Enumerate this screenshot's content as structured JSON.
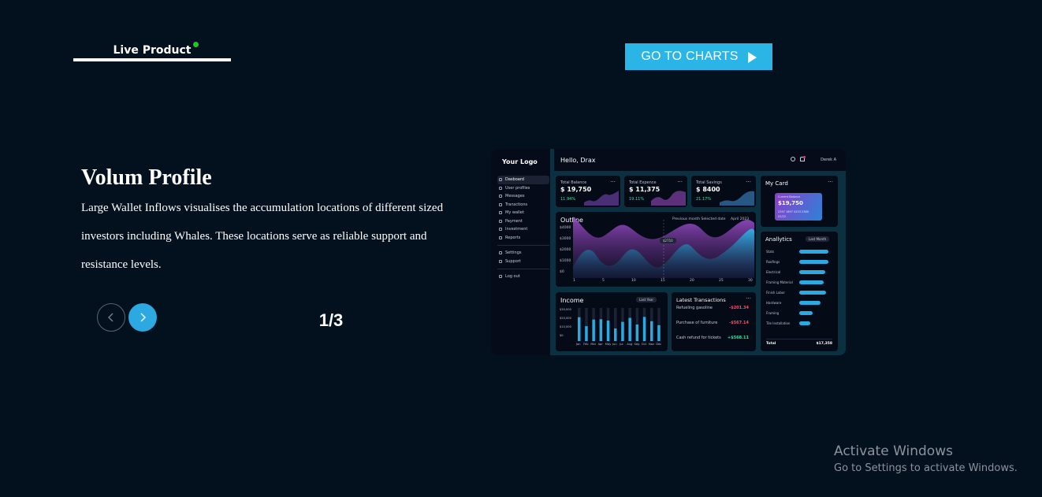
{
  "nav": {
    "tab_label": "Live Product"
  },
  "cta": {
    "label": "GO TO CHARTS"
  },
  "slide": {
    "title": "Volum Profile",
    "description": "Large Wallet Inflows visualises the accumulation locations of different sized investors including Whales. These locations serve as reliable support and resistance levels.",
    "counter": "1/3"
  },
  "preview": {
    "logo": "Your Logo",
    "greeting": "Hello, Drax",
    "user": "Derek A",
    "menu": [
      "Dasboard",
      "User profiles",
      "Messages",
      "Transctions",
      "My wallet",
      "Payment",
      "Investment",
      "Reports"
    ],
    "menu_bottom": [
      "Settings",
      "Support"
    ],
    "logout": "Log out",
    "cards": [
      {
        "title": "Total Balance",
        "value": "$ 19,750",
        "pct": "11.94%"
      },
      {
        "title": "Total Expence",
        "value": "$ 11,375",
        "pct": "19.11%"
      },
      {
        "title": "Total Savings",
        "value": "$ 8400",
        "pct": "21.17%"
      }
    ],
    "my_card": {
      "title": "My Card",
      "label": "Current Balance",
      "value": "$19,750",
      "number": "2357 1897 4253 2380",
      "expiry": "02/22"
    },
    "outline": {
      "title": "Outline",
      "legend": "Previous month  Selected date",
      "period": "April 2023",
      "tooltip": "$2710",
      "y_ticks": [
        "$4000",
        "$3000",
        "$2000",
        "$1000",
        "$0"
      ],
      "x_ticks": [
        "1",
        "5",
        "10",
        "15",
        "20",
        "25",
        "30"
      ]
    },
    "analytics": {
      "title": "Anallytics",
      "filter": "Last Month",
      "items": [
        {
          "label": "Stats",
          "value": 0.92
        },
        {
          "label": "Roofings",
          "value": 0.92
        },
        {
          "label": "Electrical",
          "value": 0.82
        },
        {
          "label": "Framing Material",
          "value": 0.78
        },
        {
          "label": "Finish Labor",
          "value": 0.84
        },
        {
          "label": "Hardware",
          "value": 0.68
        },
        {
          "label": "Framing",
          "value": 0.42
        },
        {
          "label": "Tile Installation",
          "value": 0.34
        }
      ],
      "total_label": "Total",
      "total_value": "$17,358"
    },
    "income": {
      "title": "Income",
      "filter": "Last Year",
      "y_ticks": [
        "$30,000",
        "$20,000",
        "$10,000",
        "$0"
      ],
      "months": [
        "Jan",
        "Feb",
        "Mar",
        "Apr",
        "May",
        "Jun",
        "Jul",
        "Aug",
        "Sep",
        "Oct",
        "Nov",
        "Dec"
      ],
      "values": [
        0.72,
        0.45,
        0.65,
        0.66,
        0.62,
        0.38,
        0.58,
        0.7,
        0.5,
        0.73,
        0.6,
        0.48
      ]
    },
    "transactions": {
      "title": "Latest Transactions",
      "items": [
        {
          "label": "Refueling gasoline",
          "amount": "-$201.34",
          "type": "neg"
        },
        {
          "label": "Purchase of furniture",
          "amount": "-$567.14",
          "type": "neg"
        },
        {
          "label": "Cash refund for tickets",
          "amount": "+$568.11",
          "type": "pos"
        }
      ]
    }
  },
  "os_overlay": {
    "title": "Activate Windows",
    "subtitle": "Go to Settings to activate Windows."
  },
  "colors": {
    "background": "#03101e",
    "accent": "#2bb5e6",
    "live_dot": "#1ec81e",
    "negative": "#ff4d6d",
    "positive": "#2ee59d"
  }
}
